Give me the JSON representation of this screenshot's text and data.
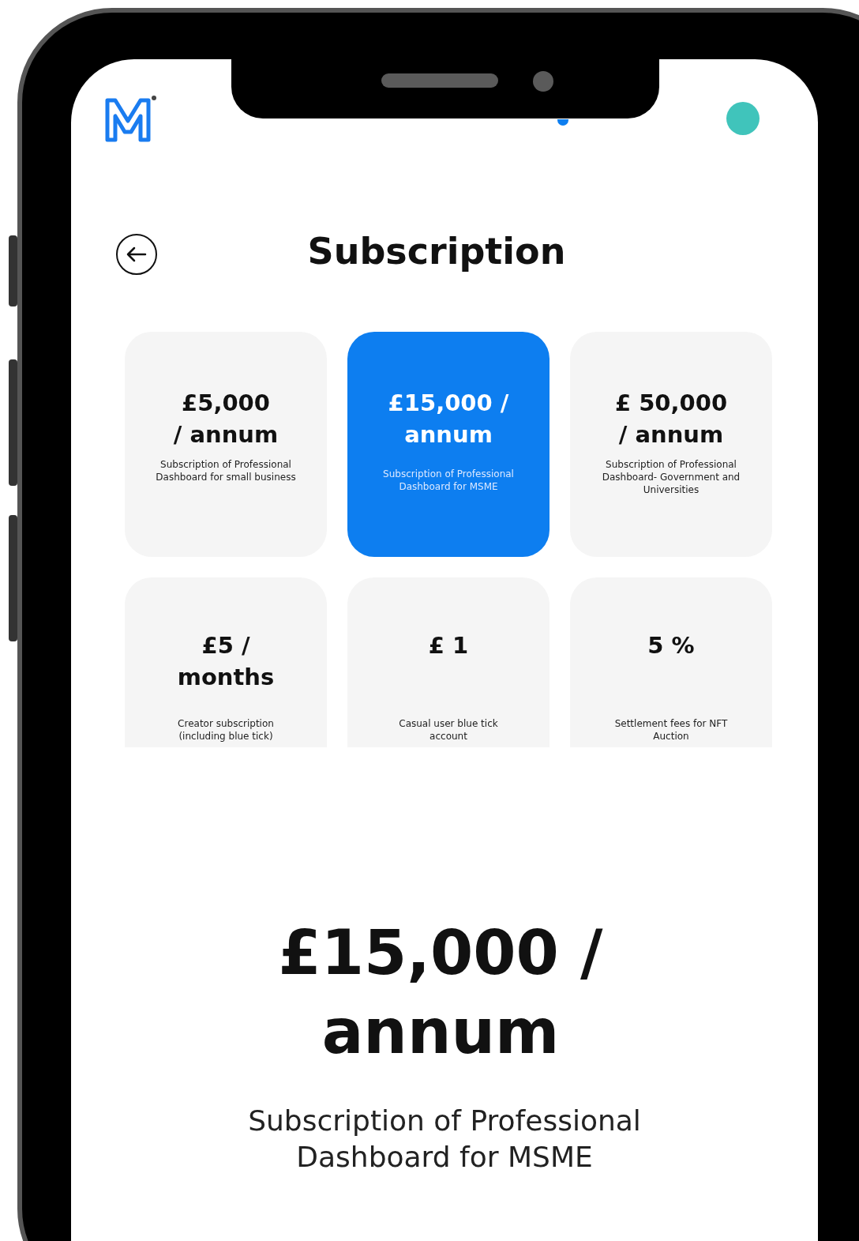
{
  "header": {
    "status_dot": {
      "color": "#0d7ef0"
    }
  },
  "title": "Subscription",
  "plans": [
    {
      "price_lines": [
        "£5,000",
        "/ annum"
      ],
      "description": "Subscription of Professional Dashboard for small business",
      "selected": false
    },
    {
      "price_lines": [
        "£15,000 /",
        "annum"
      ],
      "description": "Subscription of Professional Dashboard for MSME",
      "selected": true
    },
    {
      "price_lines": [
        "£ 50,000",
        "/ annum"
      ],
      "description": "Subscription of Professional Dashboard- Government and Universities",
      "selected": false
    },
    {
      "price_lines": [
        "£5 /",
        "months"
      ],
      "description": "Creator subscription (including blue tick)",
      "selected": false
    },
    {
      "price_lines": [
        "£ 1"
      ],
      "description": "Casual user blue tick account",
      "selected": false
    },
    {
      "price_lines": [
        "5 %"
      ],
      "description": "Settlement fees for NFT Auction",
      "selected": false
    }
  ],
  "detail": {
    "price_lines": [
      "£15,000 /",
      "annum"
    ],
    "description": "Subscription of Professional Dashboard for MSME"
  }
}
